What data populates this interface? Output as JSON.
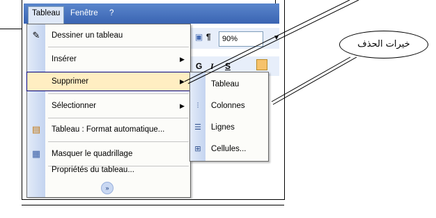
{
  "menubar": {
    "items": [
      "Tableau",
      "Fenêtre",
      "?"
    ]
  },
  "toolbar": {
    "zoom": "90%",
    "bold": "G",
    "italic": "I",
    "underline": "S"
  },
  "menu": {
    "items": [
      {
        "label": "Dessiner un tableau",
        "icon": "pencil-icon",
        "submenu": false
      },
      {
        "label": "Insérer",
        "icon": "",
        "submenu": true
      },
      {
        "label": "Supprimer",
        "icon": "",
        "submenu": true
      },
      {
        "label": "Sélectionner",
        "icon": "",
        "submenu": true
      },
      {
        "label": "Tableau : Format automatique...",
        "icon": "autoformat-icon",
        "submenu": false
      },
      {
        "label": "Masquer le quadrillage",
        "icon": "grid-icon",
        "submenu": false
      },
      {
        "label": "Propriétés du tableau...",
        "icon": "",
        "submenu": false
      }
    ]
  },
  "submenu": {
    "items": [
      {
        "label": "Tableau",
        "icon": ""
      },
      {
        "label": "Colonnes",
        "icon": "delete-columns-icon"
      },
      {
        "label": "Lignes",
        "icon": "delete-rows-icon"
      },
      {
        "label": "Cellules...",
        "icon": "delete-cells-icon"
      }
    ]
  },
  "callout": {
    "text": "خيرات الحذف"
  },
  "colors": {
    "menubar": "#3a64b2",
    "highlight": "#ffeec2",
    "gutter": "#c4d4f0"
  }
}
